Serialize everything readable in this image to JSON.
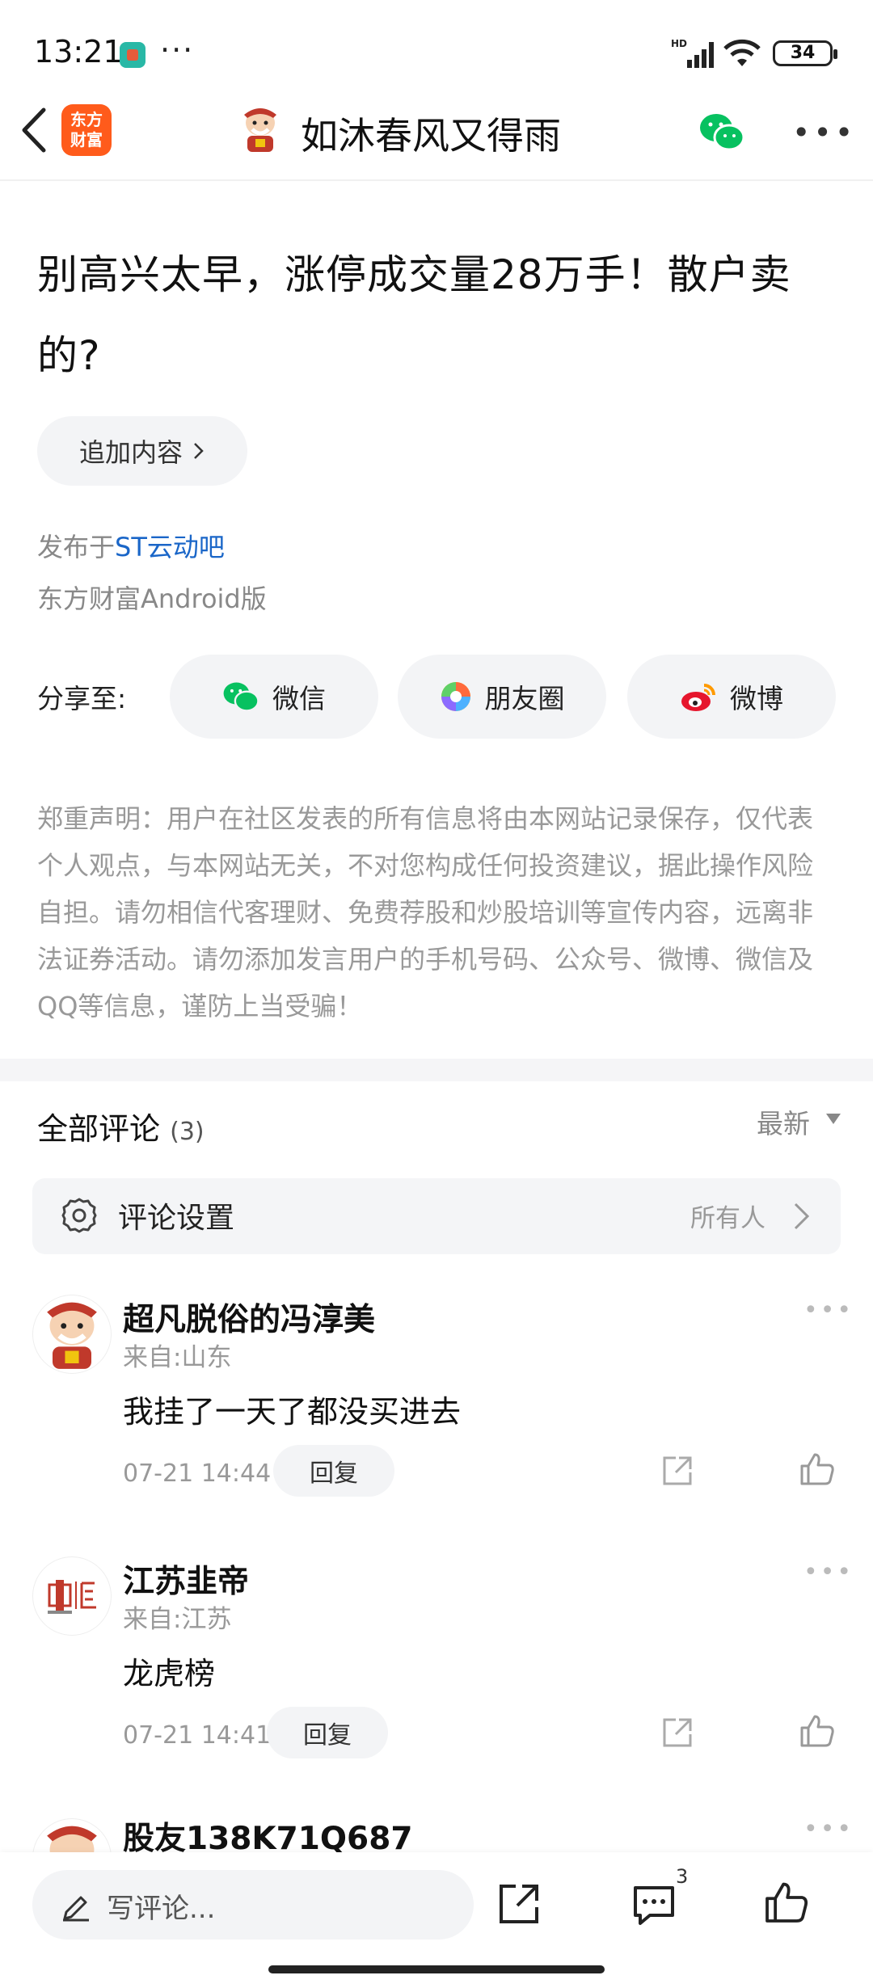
{
  "status": {
    "time": "13:21",
    "battery": "34",
    "hd": "HD"
  },
  "header": {
    "logo_line1": "东方",
    "logo_line2": "财富",
    "author": "如沐春风又得雨"
  },
  "post": {
    "title": "别高兴太早，涨停成交量28万手！散户卖的?",
    "add_content": "追加内容",
    "posted_prefix": "发布于",
    "posted_bar": "ST云动吧",
    "client": "东方财富Android版",
    "share_label": "分享至:",
    "share": {
      "wechat": "微信",
      "moments": "朋友圈",
      "weibo": "微博"
    },
    "disclaimer": "郑重声明：用户在社区发表的所有信息将由本网站记录保存，仅代表个人观点，与本网站无关，不对您构成任何投资建议，据此操作风险自担。请勿相信代客理财、免费荐股和炒股培训等宣传内容，远离非法证券活动。请勿添加发言用户的手机号码、公众号、微博、微信及QQ等信息，谨防上当受骗！"
  },
  "comments": {
    "title": "全部评论",
    "count": "(3)",
    "sort": "最新",
    "settings_label": "评论设置",
    "settings_value": "所有人",
    "reply_label": "回复",
    "items": [
      {
        "name": "超凡脱俗的冯淳美",
        "from": "来自:山东",
        "text": "我挂了一天了都没买进去",
        "time": "07-21 14:44"
      },
      {
        "name": "江苏韭帝",
        "from": "来自:江苏",
        "text": "龙虎榜",
        "time": "07-21 14:41"
      },
      {
        "name": "股友138K71Q687"
      }
    ]
  },
  "bottom": {
    "write_placeholder": "写评论...",
    "comment_count": "3"
  }
}
